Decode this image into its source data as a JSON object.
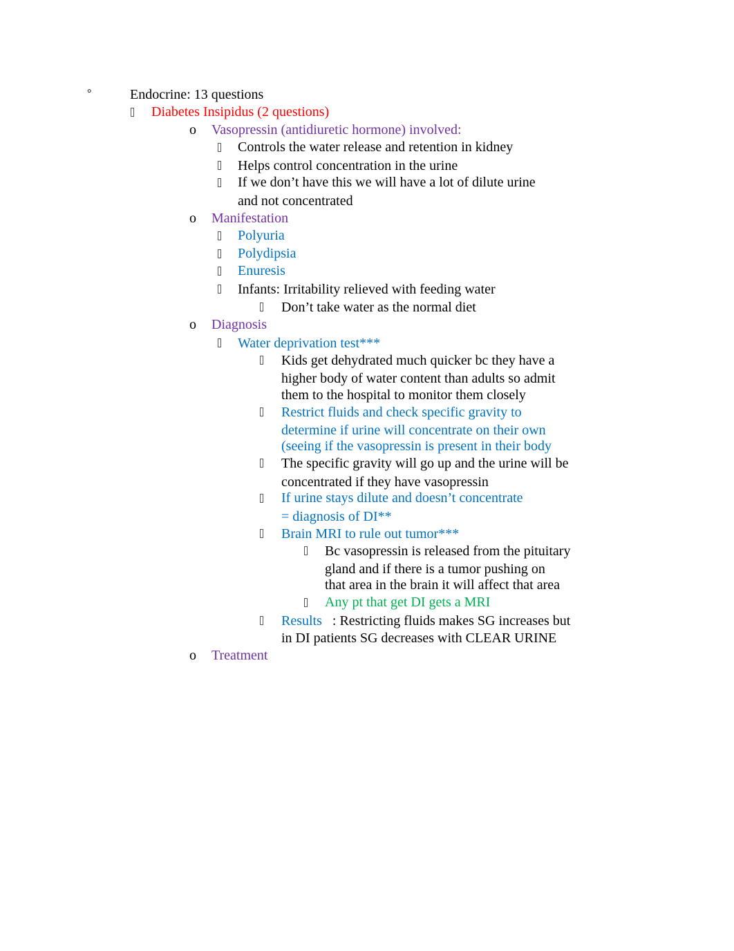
{
  "document": {
    "colors": {
      "black": "#000000",
      "red": "#FF0000",
      "purple": "#7030A0",
      "blue": "#0070C0",
      "green": "#00B050"
    },
    "bullets": {
      "level0": "°",
      "level1": "missing-glyph-box",
      "level2": "o",
      "level3": "missing-glyph-box"
    },
    "outline": {
      "topic": "Endocrine: 13 questions",
      "section": "Diabetes Insipidus (2 questions)",
      "vasopressin": {
        "heading": "Vasopressin (antidiuretic hormone) involved:",
        "items": [
          "Controls the water release and retention in kidney",
          "Helps control concentration in the urine",
          "If we don’t have this we will have a lot of dilute urine",
          "and not concentrated"
        ]
      },
      "manifestation": {
        "heading": "Manifestation",
        "items": [
          "Polyuria",
          "Polydipsia",
          "Enuresis",
          "Infants: Irritability relieved with feeding water"
        ],
        "subitems": [
          "Don’t take water as the normal diet"
        ]
      },
      "diagnosis": {
        "heading": "Diagnosis",
        "test": "Water deprivation test***",
        "test_items": [
          [
            "Kids get dehydrated much quicker bc they have a",
            "higher body of water content than adults so admit",
            "them to the hospital to monitor them closely"
          ],
          [
            "Restrict fluids and check specific gravity to",
            "determine if urine will concentrate on their own",
            "(seeing if the vasopressin is present in their body"
          ],
          [
            "The specific gravity will go up and the urine will be",
            "concentrated if they have vasopressin"
          ],
          [
            "If urine stays dilute and doesn’t concentrate",
            "= diagnosis of DI**"
          ]
        ],
        "mri": "Brain MRI to rule out tumor***",
        "mri_items": [
          [
            "Bc vasopressin is released from the pituitary",
            "gland and if there is a tumor pushing on",
            "that area in the brain it will affect that area"
          ],
          [
            "Any pt that get DI gets a MRI"
          ]
        ],
        "results_label": "Results",
        "results_text": ": Restricting fluids makes SG increases but",
        "results_text_2": "in DI patients SG decreases with CLEAR URINE"
      },
      "treatment": {
        "heading": "Treatment"
      }
    }
  }
}
